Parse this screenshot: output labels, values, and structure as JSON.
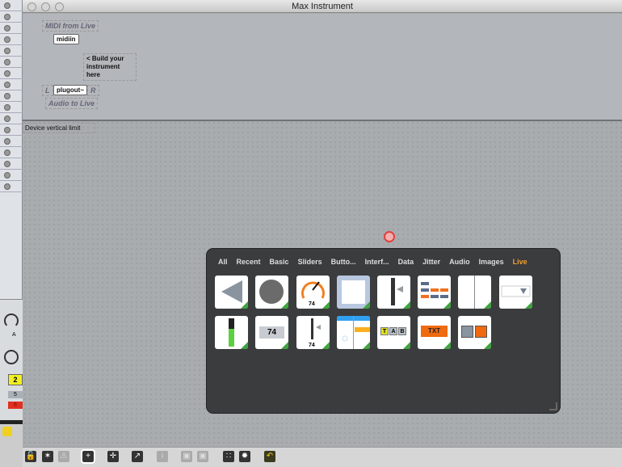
{
  "window": {
    "title": "Max Instrument"
  },
  "patch": {
    "midi_comment": "MIDI from Live",
    "midiin": "midiin",
    "build_comment": "< Build your instrument here",
    "plugout": "plugout~",
    "left": "L",
    "right": "R",
    "audio_comment": "Audio to Live",
    "device_limit": "Device vertical limit"
  },
  "palette": {
    "tabs": [
      "All",
      "Recent",
      "Basic",
      "Sliders",
      "Butto...",
      "Interf...",
      "Data",
      "Jitter",
      "Audio",
      "Images",
      "Live"
    ],
    "active_tab": "Live",
    "dial_value": "74",
    "number_value": "74",
    "slider_value": "74",
    "tab_letters": [
      "T",
      "A",
      "B"
    ],
    "text_label": "TXT"
  },
  "left_panel": {
    "badges": [
      "2",
      "5",
      "6"
    ],
    "knob_label": "A"
  },
  "colors": {
    "accent": "#f0a030",
    "green": "#3fa33f",
    "orange": "#f07020"
  }
}
